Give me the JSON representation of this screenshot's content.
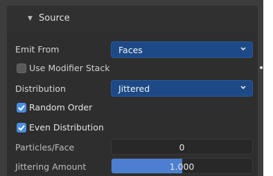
{
  "panel": {
    "title": "Source"
  },
  "emit_from": {
    "label": "Emit From",
    "value": "Faces"
  },
  "use_modifier_stack": {
    "label": "Use Modifier Stack",
    "checked": false
  },
  "distribution": {
    "label": "Distribution",
    "value": "Jittered"
  },
  "random_order": {
    "label": "Random Order",
    "checked": true
  },
  "even_distribution": {
    "label": "Even Distribution",
    "checked": true
  },
  "particles_face": {
    "label": "Particles/Face",
    "value": "0"
  },
  "jittering_amount": {
    "label": "Jittering Amount",
    "value": "1.000",
    "fill_fraction": 0.5
  },
  "colors": {
    "accent": "#4a8fe0",
    "dropdown_bg": "#1d4a86",
    "slider_fill": "#4c7fd0"
  }
}
